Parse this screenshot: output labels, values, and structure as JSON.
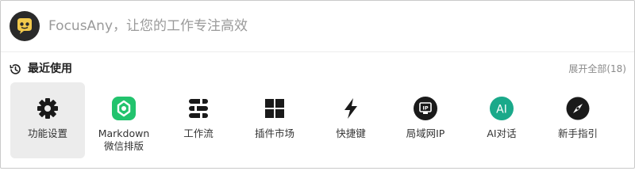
{
  "search": {
    "placeholder": "FocusAny，让您的工作专注高效",
    "logo_icon": "focusany-logo-icon"
  },
  "recent": {
    "title": "最近使用",
    "expand_label": "展开全部(18)",
    "icon": "history-clock-icon"
  },
  "items": [
    {
      "label": "功能设置",
      "icon": "gear-icon",
      "active": true
    },
    {
      "label": "Markdown\n微信排版",
      "icon": "markdown-wechat-icon",
      "color": "#22c36d"
    },
    {
      "label": "工作流",
      "icon": "workflow-icon"
    },
    {
      "label": "插件市场",
      "icon": "plugin-grid-icon"
    },
    {
      "label": "快捷键",
      "icon": "lightning-icon"
    },
    {
      "label": "局域网IP",
      "icon": "ip-badge-icon"
    },
    {
      "label": "AI对话",
      "icon": "ai-chat-icon",
      "color": "#1aa98a"
    },
    {
      "label": "新手指引",
      "icon": "compass-icon"
    }
  ],
  "colors": {
    "active_bg": "#ececec",
    "logo_yellow": "#f2c94c"
  }
}
